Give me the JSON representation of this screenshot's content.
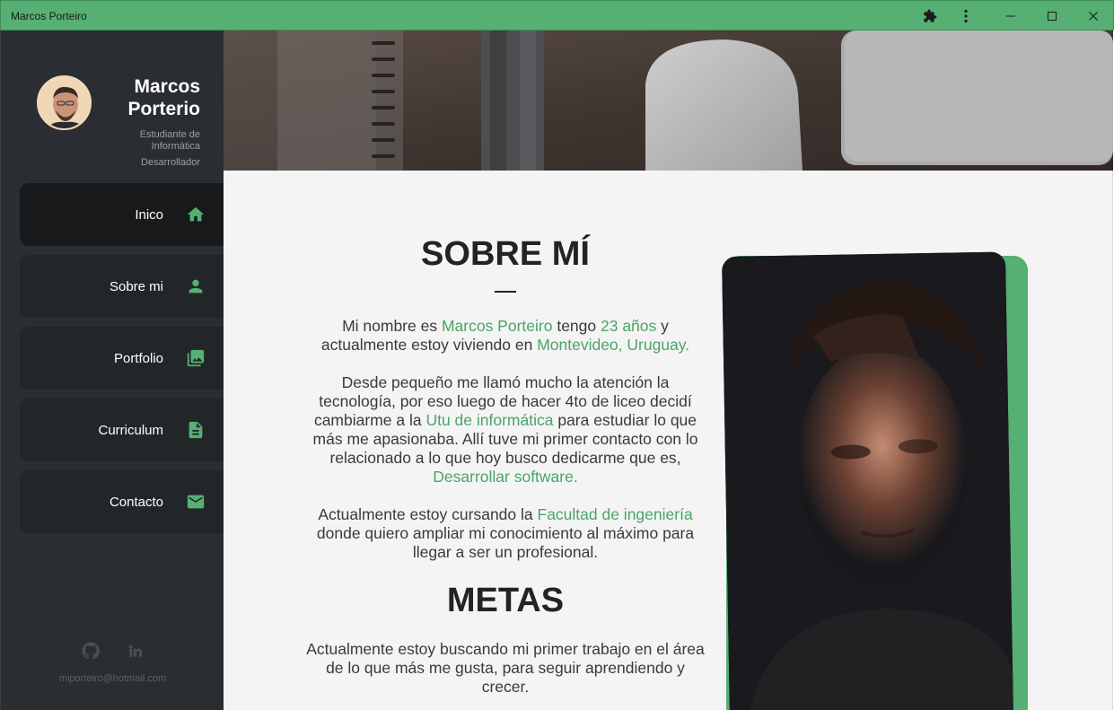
{
  "window": {
    "title": "Marcos Porteiro",
    "controls": [
      "extensions-icon",
      "more-vertical-icon",
      "minimize-icon",
      "maximize-icon",
      "close-icon"
    ]
  },
  "sidebar": {
    "name": "Marcos Porterio",
    "role_1": "Estudiante de Informática",
    "role_2": "Desarrollador",
    "nav": [
      {
        "label": "Inico",
        "icon": "home-icon",
        "active": true
      },
      {
        "label": "Sobre mi",
        "icon": "person-icon",
        "active": false
      },
      {
        "label": "Portfolio",
        "icon": "photo-library-icon",
        "active": false
      },
      {
        "label": "Curriculum",
        "icon": "document-icon",
        "active": false
      },
      {
        "label": "Contacto",
        "icon": "mail-icon",
        "active": false
      }
    ],
    "social": [
      "github-icon",
      "linkedin-icon"
    ],
    "email": "miporteiro@hotmail.com"
  },
  "about": {
    "title": "SOBRE MÍ",
    "p1": {
      "t1": "Mi nombre es ",
      "h1": "Marcos Porteiro",
      "t2": " tengo ",
      "h2": "23 años",
      "t3": " y actualmente estoy viviendo en ",
      "h3": "Montevideo, Uruguay."
    },
    "p2": {
      "t1": "Desde pequeño me llamó mucho la atención la tecnología, por eso luego de hacer 4to de liceo decidí cambiarme a la ",
      "h1": "Utu de informática",
      "t2": " para estudiar lo que más me apasionaba. Allí tuve mi primer contacto con lo relacionado a lo que hoy busco dedicarme que es, ",
      "h2": "Desarrollar software."
    },
    "p3": {
      "t1": "Actualmente estoy cursando la ",
      "h1": "Facultad de ingeniería",
      "t2": " donde quiero ampliar mi conocimiento al máximo para llegar a ser un profesional."
    }
  },
  "goals": {
    "title": "METAS",
    "p1": "Actualmente estoy buscando mi primer trabajo en el área de lo que más me gusta, para seguir aprendiendo y crecer."
  },
  "colors": {
    "accent": "#56af73",
    "highlight": "#4aa468",
    "sidebar_bg": "#2a2d31",
    "content_bg": "#f4f4f4"
  }
}
